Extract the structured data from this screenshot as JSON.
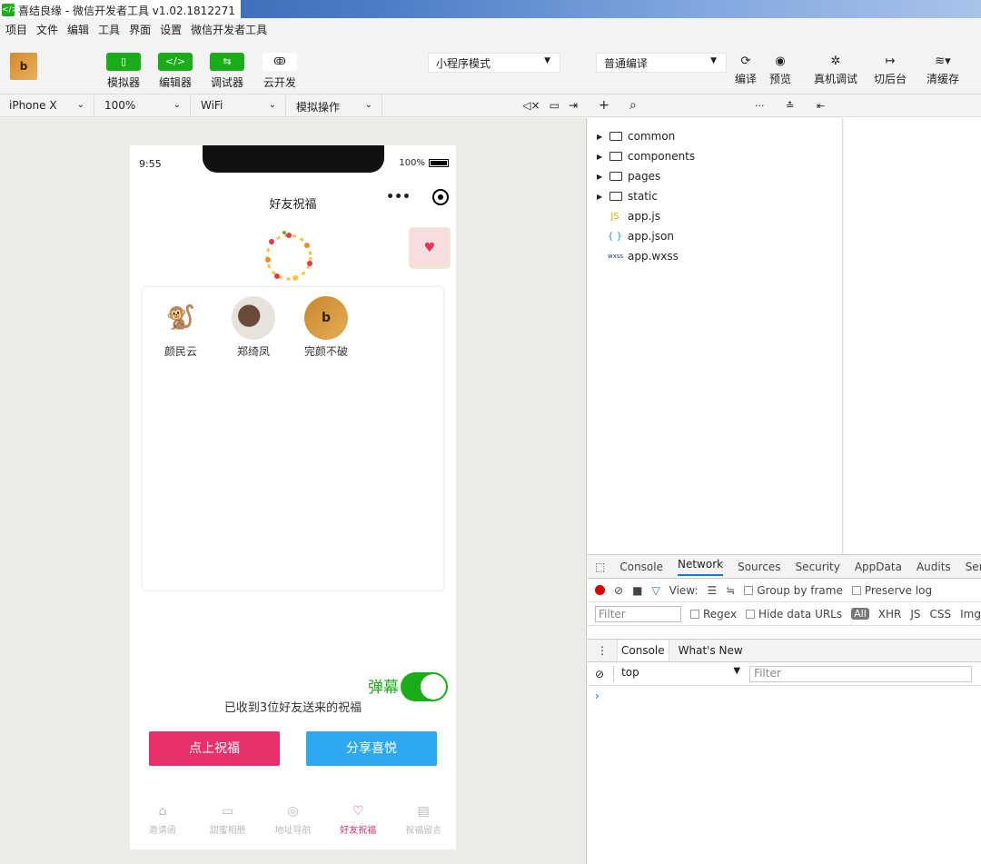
{
  "window": {
    "title": "喜结良缘 - 微信开发者工具 v1.02.1812271",
    "app_icon": "</>"
  },
  "menu": [
    "项目",
    "文件",
    "编辑",
    "工具",
    "界面",
    "设置",
    "微信开发者工具"
  ],
  "toolbar": {
    "simulator": "模拟器",
    "editor": "编辑器",
    "debugger": "调试器",
    "cloud": "云开发",
    "mode": "小程序模式",
    "compile_mode": "普通编译",
    "compile": "编译",
    "preview": "预览",
    "remote_debug": "真机调试",
    "background": "切后台",
    "clear_cache": "清缓存",
    "editor_icon": "</>"
  },
  "device_bar": {
    "device": "iPhone X",
    "zoom": "100%",
    "network": "WiFi",
    "operation": "模拟操作"
  },
  "phone": {
    "time": "9:55",
    "battery": "100%",
    "nav_title": "好友祝福",
    "friends": [
      {
        "name": "颜民云"
      },
      {
        "name": "郑绮凤"
      },
      {
        "name": "完颜不破"
      }
    ],
    "danmu_label": "弹幕",
    "danmu_on": true,
    "received_text": "已收到3位好友送来的祝福",
    "bless_button": "点上祝福",
    "share_button": "分享喜悦",
    "tabs": [
      {
        "label": "邀请函",
        "icon": "house-icon",
        "glyph": "⌂"
      },
      {
        "label": "甜蜜相册",
        "icon": "photo-icon",
        "glyph": "▭"
      },
      {
        "label": "地址导航",
        "icon": "location-icon",
        "glyph": "◎"
      },
      {
        "label": "好友祝福",
        "icon": "heart-icon",
        "glyph": "♡",
        "active": true
      },
      {
        "label": "祝福留言",
        "icon": "message-icon",
        "glyph": "▤"
      }
    ]
  },
  "file_tree": [
    {
      "name": "common",
      "type": "folder"
    },
    {
      "name": "components",
      "type": "folder"
    },
    {
      "name": "pages",
      "type": "folder"
    },
    {
      "name": "static",
      "type": "folder"
    },
    {
      "name": "app.js",
      "type": "js",
      "badge": "JS"
    },
    {
      "name": "app.json",
      "type": "json",
      "badge": "{ }"
    },
    {
      "name": "app.wxss",
      "type": "wxss",
      "badge": "wxss"
    }
  ],
  "devtools": {
    "tabs": [
      "Console",
      "Network",
      "Sources",
      "Security",
      "AppData",
      "Audits",
      "Sensor"
    ],
    "active_tab": "Network",
    "view_label": "View:",
    "group_by_frame": "Group by frame",
    "preserve_log": "Preserve log",
    "filter_placeholder": "Filter",
    "regex": "Regex",
    "hide_data_urls": "Hide data URLs",
    "all": "All",
    "types": [
      "XHR",
      "JS",
      "CSS",
      "Img"
    ],
    "console_tabs": [
      "Console",
      "What's New"
    ],
    "context": "top",
    "console_filter": "Filter",
    "prompt": "›"
  },
  "colors": {
    "accent_green": "#1aad19",
    "pink": "#e9306b",
    "blue": "#2ea8f2"
  }
}
